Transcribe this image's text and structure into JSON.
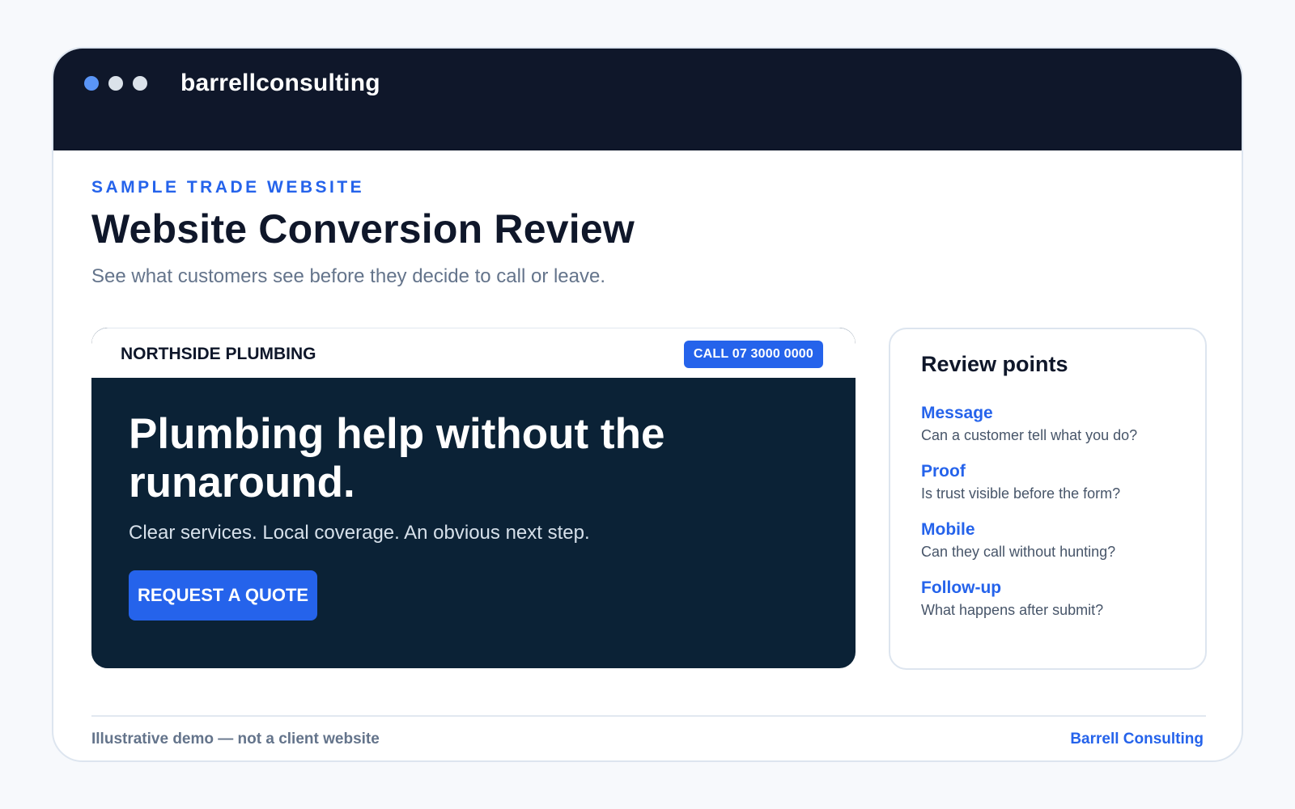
{
  "window": {
    "title": "barrellconsulting",
    "dots": [
      "blue-dot",
      "gray-dot",
      "gray-dot"
    ]
  },
  "page": {
    "eyebrow": "SAMPLE TRADE WEBSITE",
    "title": "Website Conversion Review",
    "subtitle": "See what customers see before they decide to call or leave."
  },
  "mock_site": {
    "brand": "NORTHSIDE PLUMBING",
    "call_label": "CALL 07 3000 0000",
    "hero_title": "Plumbing help without the runaround.",
    "hero_subtitle": "Clear services. Local coverage. An obvious next step.",
    "cta_label": "REQUEST A QUOTE"
  },
  "review": {
    "title": "Review points",
    "items": [
      {
        "title": "Message",
        "desc": "Can a customer tell what you do?"
      },
      {
        "title": "Proof",
        "desc": "Is trust visible before the form?"
      },
      {
        "title": "Mobile",
        "desc": "Can they call without hunting?"
      },
      {
        "title": "Follow-up",
        "desc": "What happens after submit?"
      }
    ]
  },
  "footer": {
    "note": "Illustrative demo — not a client website",
    "brand": "Barrell Consulting"
  },
  "colors": {
    "titlebar": "#0f172a",
    "accent": "#2563eb",
    "hero_bg": "#0b2236",
    "muted_text": "#64748b"
  }
}
